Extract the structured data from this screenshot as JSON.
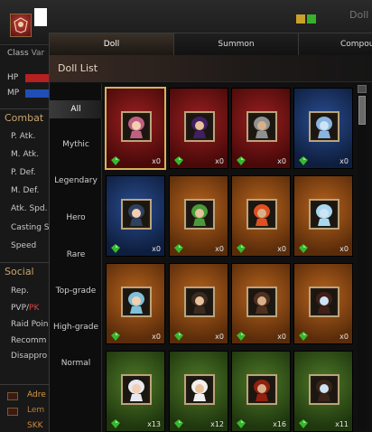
{
  "background": {
    "header_title": "Doll",
    "class_label": "Class",
    "class_value": "Var",
    "hp_label": "HP",
    "mp_label": "MP",
    "combat_title": "Combat",
    "combat_stats": [
      "P. Atk.",
      "M. Atk.",
      "P. Def.",
      "M. Def.",
      "Atk. Spd.",
      "Casting S",
      "Speed"
    ],
    "social_title": "Social",
    "social_stats": [
      "Rep.",
      "Raid Poin",
      "Recomm",
      "Disappro"
    ],
    "pvp_label": "PVP/",
    "pk_label": "PK",
    "party": [
      {
        "name": "Adre",
        "color": "#d39a47"
      },
      {
        "name": "Lem",
        "color": "#c07a3a"
      },
      {
        "name": "SKK",
        "color": "#d28a3a"
      }
    ]
  },
  "tabs": [
    {
      "label": "Doll",
      "active": true
    },
    {
      "label": "Summon",
      "active": false
    },
    {
      "label": "Compou",
      "active": false
    }
  ],
  "list_title": "Doll List",
  "categories": [
    {
      "label": "All",
      "active": true
    },
    {
      "label": "Mythic"
    },
    {
      "label": "Legendary"
    },
    {
      "label": "Hero"
    },
    {
      "label": "Rare"
    },
    {
      "label": "Top-grade"
    },
    {
      "label": "High-grade"
    },
    {
      "label": "Normal"
    }
  ],
  "dolls": [
    {
      "count": "x0",
      "color": "red",
      "icon": "pink-haired-doll-icon"
    },
    {
      "count": "x0",
      "color": "red",
      "icon": "witch-doll-icon"
    },
    {
      "count": "x0",
      "color": "red",
      "icon": "grey-haired-doll-icon"
    },
    {
      "count": "x0",
      "color": "blue",
      "icon": "ice-spirit-doll-icon"
    },
    {
      "count": "x0",
      "color": "blue",
      "icon": "dark-knight-doll-icon"
    },
    {
      "count": "x0",
      "color": "orange",
      "icon": "frog-doll-icon"
    },
    {
      "count": "x0",
      "color": "orange",
      "icon": "fire-demon-doll-icon"
    },
    {
      "count": "x0",
      "color": "orange",
      "icon": "ice-golem-doll-icon"
    },
    {
      "count": "x0",
      "color": "orange",
      "icon": "blue-haired-doll-icon"
    },
    {
      "count": "x0",
      "color": "orange",
      "icon": "dark-elf-doll-icon"
    },
    {
      "count": "x0",
      "color": "orange",
      "icon": "hooded-warrior-doll-icon"
    },
    {
      "count": "x0",
      "color": "orange",
      "icon": "hat-mage-doll-icon"
    },
    {
      "count": "x13",
      "color": "green",
      "icon": "white-haired-doll-icon"
    },
    {
      "count": "x12",
      "color": "green",
      "icon": "brown-haired-doll-icon"
    },
    {
      "count": "x16",
      "color": "green",
      "icon": "red-armored-doll-icon"
    },
    {
      "count": "x11",
      "color": "green",
      "icon": "dark-haired-doll-icon"
    }
  ],
  "colors": {
    "accent": "#d8b45a",
    "gem": "#37b82e"
  }
}
